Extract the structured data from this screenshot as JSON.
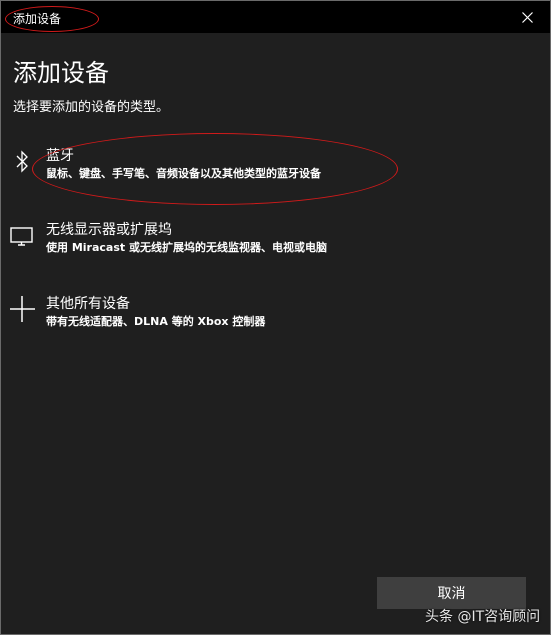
{
  "window": {
    "title": "添加设备",
    "close_icon": "close-icon"
  },
  "main": {
    "heading": "添加设备",
    "subtitle": "选择要添加的设备的类型。",
    "options": [
      {
        "icon": "bluetooth-icon",
        "label": "蓝牙",
        "description": "鼠标、键盘、手写笔、音频设备以及其他类型的蓝牙设备"
      },
      {
        "icon": "monitor-icon",
        "label": "无线显示器或扩展坞",
        "description": "使用 Miracast 或无线扩展坞的无线监视器、电视或电脑"
      },
      {
        "icon": "plus-icon",
        "label": "其他所有设备",
        "description": "带有无线适配器、DLNA 等的 Xbox 控制器"
      }
    ]
  },
  "footer": {
    "cancel_label": "取消"
  },
  "watermark": "头条 @IT咨询顾问",
  "colors": {
    "window_bg": "#1f1f1f",
    "titlebar_bg": "#000000",
    "button_bg": "#3f3f3f",
    "annotation": "#d11a1a"
  }
}
